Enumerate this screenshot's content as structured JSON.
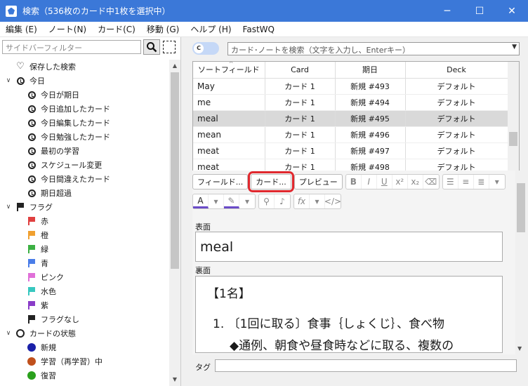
{
  "window": {
    "title": "検索（536枚のカード中1枚を選択中）",
    "minimize": "─",
    "maximize": "☐",
    "close": "✕"
  },
  "menu": [
    "編集 (E)",
    "ノート(N)",
    "カード(C)",
    "移動 (G)",
    "ヘルプ (H)",
    "FastWQ"
  ],
  "sidebar": {
    "filter_placeholder": "サイドバーフィルター",
    "saved_search": "保存した検索",
    "today": {
      "label": "今日",
      "items": [
        "今日が期日",
        "今日追加したカード",
        "今日編集したカード",
        "今日勉強したカード",
        "最初の学習",
        "スケジュール変更",
        "今日間違えたカード",
        "期日超過"
      ]
    },
    "flags": {
      "label": "フラグ",
      "items": [
        {
          "label": "赤",
          "color": "#e04040"
        },
        {
          "label": "橙",
          "color": "#f0a030"
        },
        {
          "label": "緑",
          "color": "#3cb043"
        },
        {
          "label": "青",
          "color": "#4a7de8"
        },
        {
          "label": "ピンク",
          "color": "#e070d8"
        },
        {
          "label": "水色",
          "color": "#38c8c0"
        },
        {
          "label": "紫",
          "color": "#8a3cc8"
        }
      ],
      "none": "フラグなし"
    },
    "card_state": {
      "label": "カードの状態",
      "items": [
        {
          "label": "新規",
          "color": "#1a20a8"
        },
        {
          "label": "学習（再学習）中",
          "color": "#c0501c"
        },
        {
          "label": "復習",
          "color": "#2aa01c"
        }
      ]
    }
  },
  "search": {
    "mode_letter": "C",
    "placeholder": "カード･ノートを検索（文字を入力し、Enterキー）"
  },
  "table": {
    "columns": [
      "ソートフィールド",
      "Card",
      "期日",
      "Deck"
    ],
    "rows": [
      [
        "May",
        "カード 1",
        "新規 #493",
        "デフォルト"
      ],
      [
        "me",
        "カード 1",
        "新規 #494",
        "デフォルト"
      ],
      [
        "meal",
        "カード 1",
        "新規 #495",
        "デフォルト"
      ],
      [
        "mean",
        "カード 1",
        "新規 #496",
        "デフォルト"
      ],
      [
        "meat",
        "カード 1",
        "新規 #497",
        "デフォルト"
      ],
      [
        "meat",
        "カード 1",
        "新規 #498",
        "デフォルト"
      ]
    ],
    "selected_index": 2
  },
  "editor": {
    "btn_fields": "フィールド...",
    "btn_cards": "カード...",
    "btn_preview": "プレビュー",
    "front_label": "表面",
    "front_value": "meal",
    "back_label": "裏面",
    "back_line1": "【1名】",
    "back_line2": "1. 〔1回に取る〕食事｛しょくじ｝、食べ物",
    "back_line3": "◆通例、朝食や昼食時などに取る、複数の",
    "tags_label": "タグ"
  }
}
